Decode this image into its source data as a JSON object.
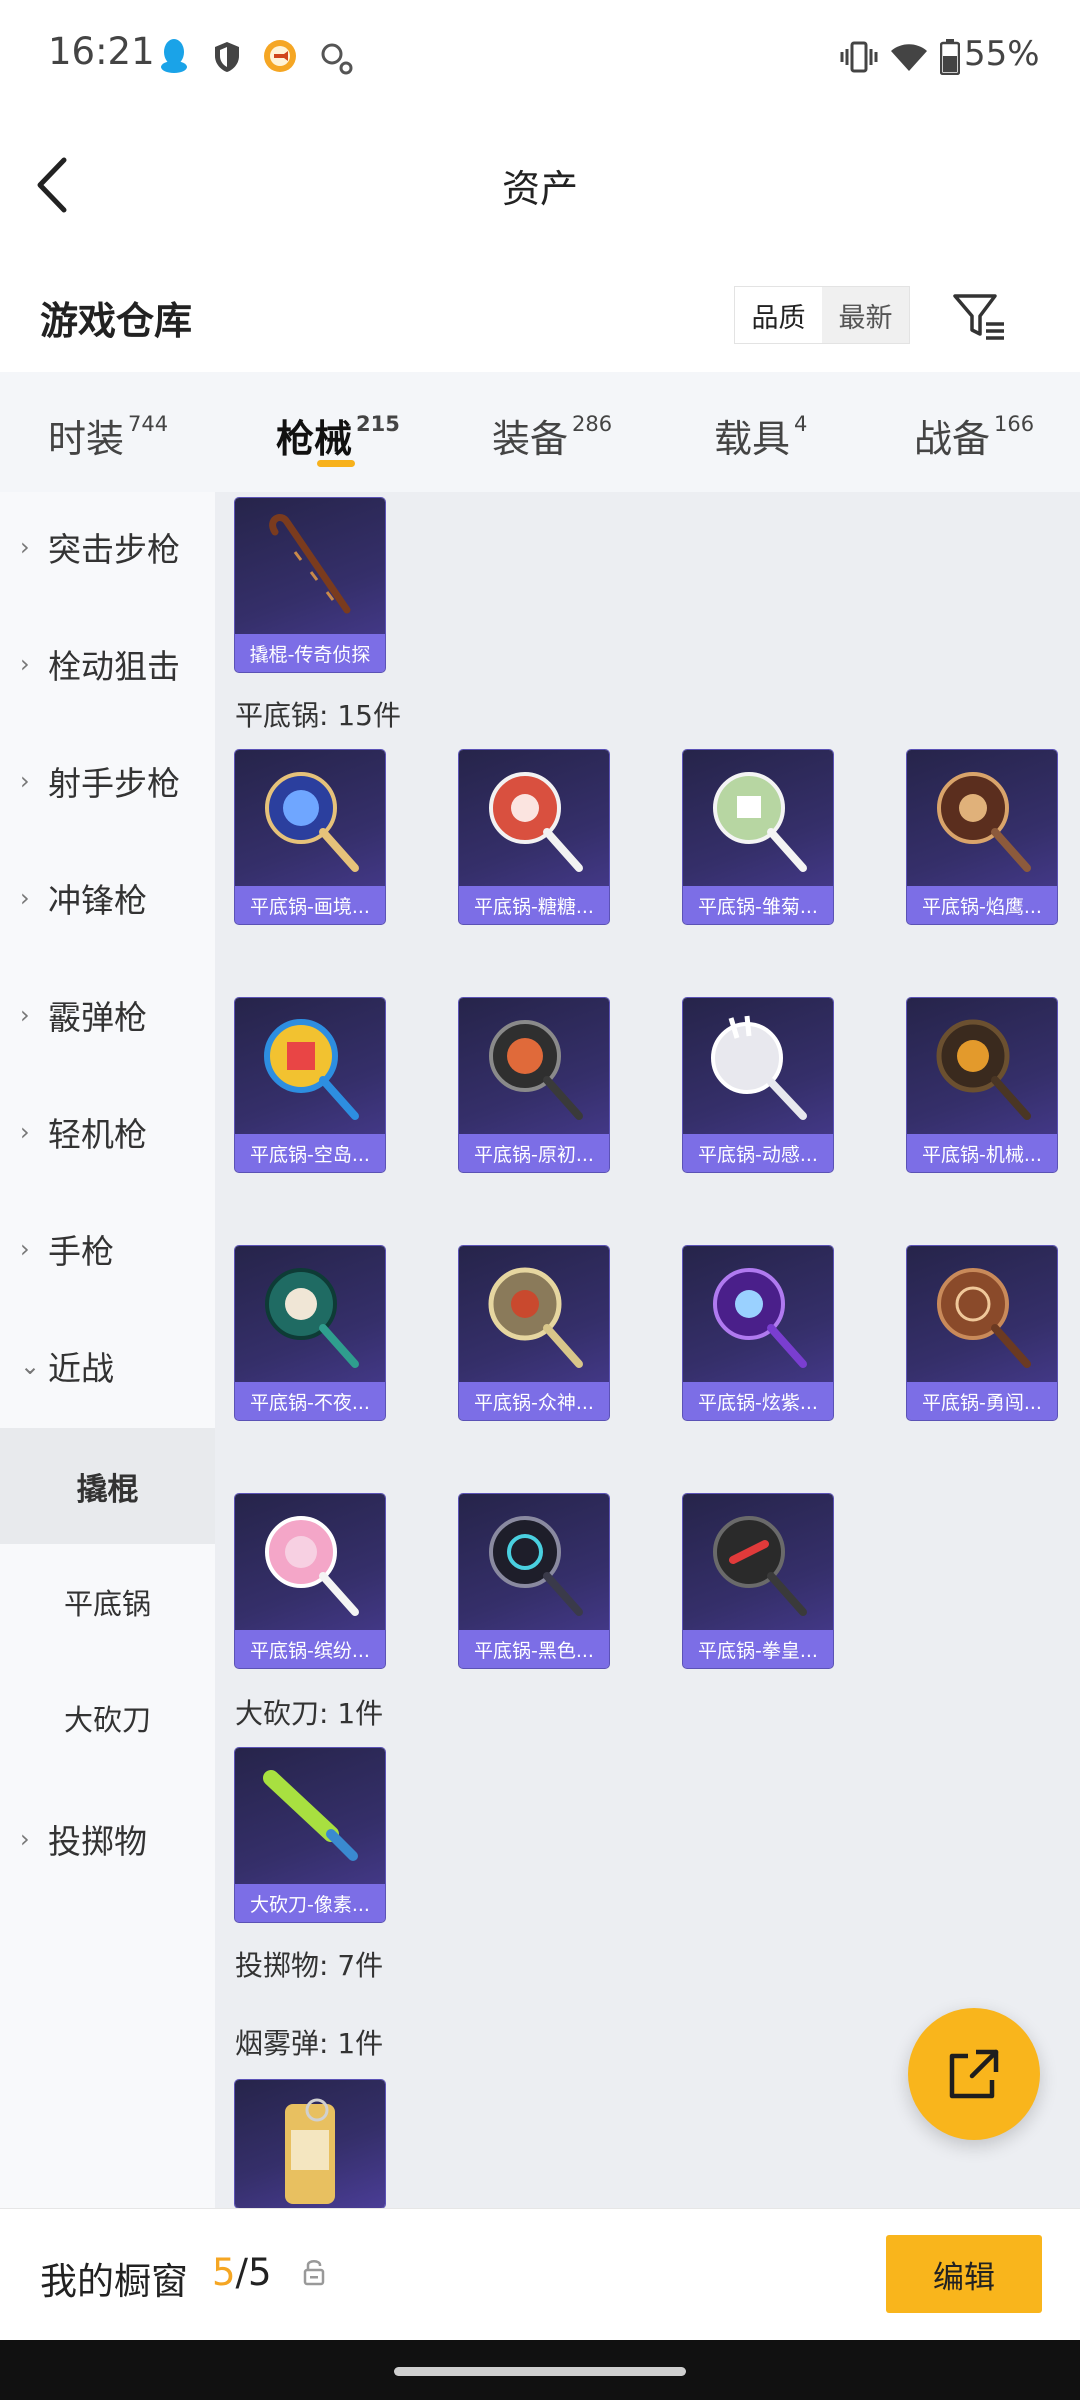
{
  "status_bar": {
    "time": "16:21",
    "battery": "55%"
  },
  "header": {
    "title": "资产"
  },
  "section": {
    "title": "游戏仓库",
    "sort_options": [
      "品质",
      "最新"
    ]
  },
  "tabs": [
    {
      "label": "时装",
      "count": "744"
    },
    {
      "label": "枪械",
      "count": "215"
    },
    {
      "label": "装备",
      "count": "286"
    },
    {
      "label": "载具",
      "count": "4"
    },
    {
      "label": "战备",
      "count": "166"
    }
  ],
  "sidebar": {
    "categories": [
      "突击步枪",
      "栓动狙击",
      "射手步枪",
      "冲锋枪",
      "霰弹枪",
      "轻机枪",
      "手枪",
      "近战"
    ],
    "subcategories": [
      "撬棍",
      "平底锅",
      "大砍刀"
    ],
    "last_category": "投掷物"
  },
  "content": {
    "crowbar_item": "撬棍-传奇侦探",
    "pan_label": "平底锅: 15件",
    "pans": [
      "平底锅-画境...",
      "平底锅-糖糖...",
      "平底锅-雏菊...",
      "平底锅-焰鹰...",
      "平底锅-空岛...",
      "平底锅-原初...",
      "平底锅-动感...",
      "平底锅-机械...",
      "平底锅-不夜...",
      "平底锅-众神...",
      "平底锅-炫紫...",
      "平底锅-勇闯...",
      "平底锅-缤纷...",
      "平底锅-黑色...",
      "平底锅-拳皇..."
    ],
    "machete_label": "大砍刀: 1件",
    "machete_item": "大砍刀-像素...",
    "throwables_label": "投掷物: 7件",
    "smoke_label": "烟雾弹: 1件"
  },
  "bottom": {
    "label": "我的橱窗",
    "current": "5",
    "separator": "/",
    "total": "5",
    "edit_label": "编辑"
  },
  "colors": {
    "accent": "#f9b51c",
    "card_caption": "#7c6ee6",
    "card_bg": "#2e2a5e"
  }
}
